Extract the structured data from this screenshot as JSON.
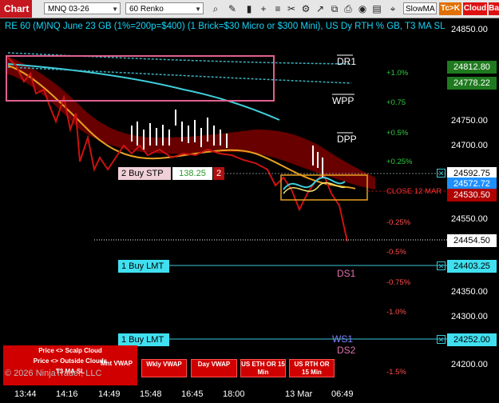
{
  "toolbar": {
    "chart_tab": "Chart",
    "instrument": "MNQ 03-26",
    "bar_type": "60 Renko",
    "slowma": "SlowMA",
    "tc_k": "Tc>K",
    "cloud": "Cloud",
    "ba": "Ba",
    "icons": [
      "search-icon",
      "pencil-icon",
      "bars-icon",
      "plus-icon",
      "list-icon",
      "scissors-icon",
      "gear-icon",
      "drawing-icon",
      "copy-icon",
      "print-icon",
      "camera-icon",
      "template-icon"
    ]
  },
  "chart": {
    "title": "RE 60 (M)NQ June 23 GB (1%=200p=$400) (1 Brick=$30 Micro or $300 Mini), US Dy RTH % GB, T3 MA SL",
    "copyright": "© 2026 NinjaTrader, LLC",
    "price_ticks": [
      "24850.00",
      "24800.00",
      "24750.00",
      "24700.00",
      "24650.00",
      "24600.00",
      "24550.00",
      "24500.00",
      "24450.00",
      "24400.00",
      "24350.00",
      "24300.00",
      "24250.00",
      "24200.00"
    ],
    "price_boxes": [
      {
        "label": "24812.80",
        "color": "#1f7a1f"
      },
      {
        "label": "24778.22",
        "color": "#1f7a1f"
      },
      {
        "label": "24592.75",
        "color": "#ffffff"
      },
      {
        "label": "24572.72",
        "color": "#1e90ff"
      },
      {
        "label": "24530.50",
        "color": "#b00000"
      },
      {
        "label": "24454.50",
        "color": "#ffffff"
      },
      {
        "label": "24403.25",
        "color": "#40e0f0"
      },
      {
        "label": "24252.00",
        "color": "#40e0f0"
      }
    ],
    "time_labels": [
      "13:44",
      "14:16",
      "14:49",
      "15:48",
      "16:45",
      "18:00",
      "13 Mar",
      "06:49"
    ],
    "percent_labels": [
      {
        "text": "+1.0%",
        "color": "#2ecc40"
      },
      {
        "text": "+0.75",
        "color": "#2ecc40"
      },
      {
        "text": "+0.5%",
        "color": "#2ecc40"
      },
      {
        "text": "+0.25%",
        "color": "#2ecc40"
      },
      {
        "text": "-0.25%",
        "color": "#ff4d4d"
      },
      {
        "text": "-0.5%",
        "color": "#ff4d4d"
      },
      {
        "text": "-0.75%",
        "color": "#ff4d4d"
      },
      {
        "text": "-1.0%",
        "color": "#ff4d4d"
      },
      {
        "text": "-1.5%",
        "color": "#ff4d4d"
      }
    ],
    "levels": {
      "dr1": "DR1",
      "wpp": "WPP",
      "dpp": "DPP",
      "ds1": "DS1",
      "ws1": "WS1",
      "ds2": "DS2"
    },
    "close_label": "CLOSE 12 MAR",
    "orders": {
      "buy_stp": {
        "label": "2 Buy STP",
        "pnl": "138.25",
        "qty": "2"
      },
      "buy_lmt_1": {
        "label": "1 Buy LMT"
      },
      "buy_lmt_2": {
        "label": "1 Buy LMT"
      }
    },
    "buttons": {
      "scalp_cloud": "Price <> Scalp Cloud",
      "outside_clouds": "Price <> Outside Clouds",
      "t3_ma_sl": "T3 MA SL",
      "mnt_vwap": "Mnt VWAP",
      "wkly_vwap": "Wkly VWAP",
      "day_vwap": "Day VWAP",
      "us_eth": "US ETH OR 15 Min",
      "us_rth": "US RTH OR 15 Min"
    },
    "colors": {
      "accent": "#c4171f",
      "ma_cyan": "#3fd0dc",
      "ma_orange": "#e8a020",
      "price_red": "#cc1111"
    }
  }
}
